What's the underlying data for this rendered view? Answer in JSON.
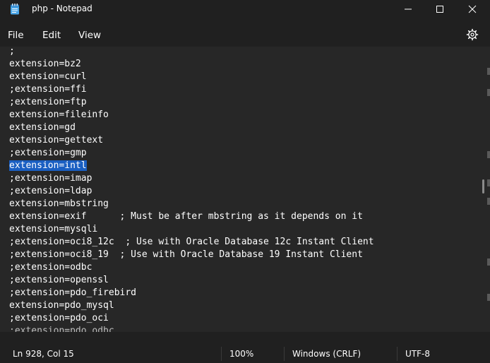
{
  "window": {
    "title": "php - Notepad"
  },
  "menu": {
    "file": "File",
    "edit": "Edit",
    "view": "View"
  },
  "editor": {
    "lines": [
      ";",
      "extension=bz2",
      "extension=curl",
      ";extension=ffi",
      ";extension=ftp",
      "extension=fileinfo",
      "extension=gd",
      "extension=gettext",
      ";extension=gmp",
      "extension=intl",
      ";extension=imap",
      ";extension=ldap",
      "extension=mbstring",
      "extension=exif      ; Must be after mbstring as it depends on it",
      "extension=mysqli",
      ";extension=oci8_12c  ; Use with Oracle Database 12c Instant Client",
      ";extension=oci8_19  ; Use with Oracle Database 19 Instant Client",
      ";extension=odbc",
      ";extension=openssl",
      ";extension=pdo_firebird",
      "extension=pdo_mysql",
      ";extension=pdo_oci",
      ";extension=pdo_odbc"
    ],
    "selected_line": 9
  },
  "status": {
    "position": "Ln 928, Col 15",
    "zoom": "100%",
    "line_ending": "Windows (CRLF)",
    "encoding": "UTF-8"
  },
  "colors": {
    "selection": "#1a5fc2",
    "background": "#272727",
    "chrome": "#202020"
  }
}
